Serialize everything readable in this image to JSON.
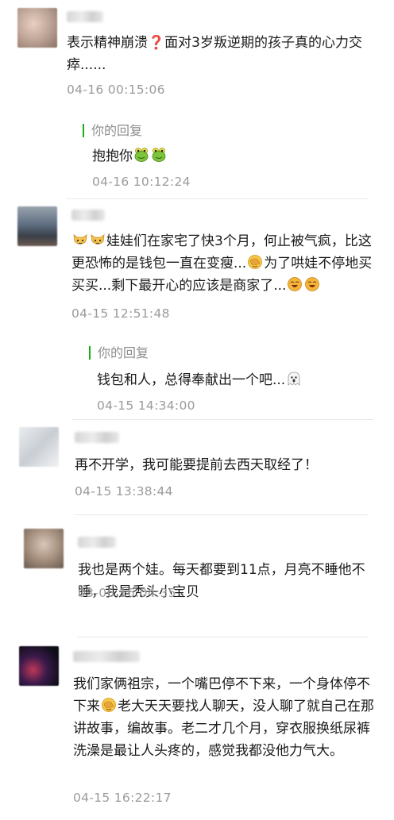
{
  "comments": [
    {
      "text": "表示精神崩溃❓面对3岁叛逆期的孩子真的心力交瘁......",
      "time": "04-16 00:15:06",
      "reply": {
        "label": "你的回复",
        "text": "抱抱你",
        "time": "04-16 10:12:24"
      }
    },
    {
      "text_a": "娃娃们在家宅了快3个月，何止被气疯，比这更恐怖的是钱包一直在变瘦...",
      "text_b": "为了哄娃不停地买买买...剩下最开心的应该是商家了...",
      "time": "04-15 12:51:48",
      "reply": {
        "label": "你的回复",
        "text": "钱包和人，总得奉献出一个吧...",
        "time": "04-15 14:34:00"
      }
    },
    {
      "text": "再不开学，我可能要提前去西天取经了！",
      "time": "04-15 13:38:44"
    },
    {
      "text": "我也是两个娃。每天都要到11点，月亮不睡他不睡，我是秃头小宝贝",
      "time": "03-06 16:04:35"
    },
    {
      "text_a": "我们家俩祖宗，一个嘴巴停不下来，一个身体停不下来",
      "text_b": "老大天天要找人聊天，没人聊了就自己在那讲故事，编故事。老二才几个月，穿衣服换纸尿裤洗澡是最让人头疼的，感觉我都没他力气大。",
      "time": "04-15 16:22:17"
    }
  ],
  "colors": {
    "reply_bar": "#1aad19",
    "time": "#9b9b9b",
    "reply_label": "#8d8d8d"
  },
  "emoji_names": [
    "frog-face",
    "cat-face",
    "facepalm-laugh",
    "grin-face",
    "ghost"
  ]
}
